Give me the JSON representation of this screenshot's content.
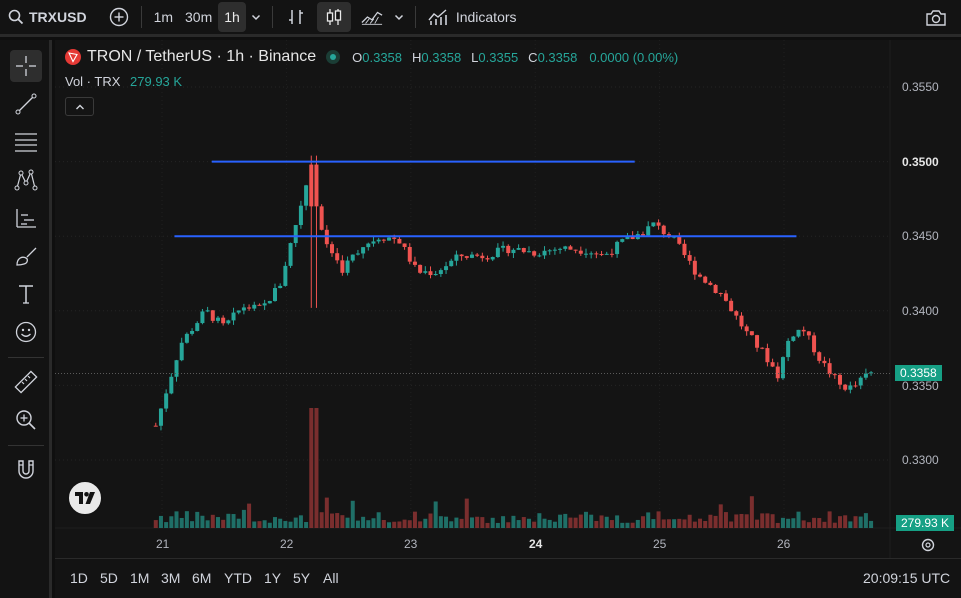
{
  "toolbar": {
    "symbol": "TRXUSD",
    "intervals": [
      "1m",
      "30m",
      "1h"
    ],
    "active_interval": "1h",
    "indicators_label": "Indicators"
  },
  "legend": {
    "title": "TRON / TetherUS · 1h · Binance",
    "o_label": "O",
    "o_value": "0.3358",
    "h_label": "H",
    "h_value": "0.3358",
    "l_label": "L",
    "l_value": "0.3355",
    "c_label": "C",
    "c_value": "0.3358",
    "change": "0.0000 (0.00%)",
    "vol_label": "Vol · TRX",
    "vol_value": "279.93 K"
  },
  "price_axis": {
    "ticks": [
      "0.3550",
      "0.3500",
      "0.3450",
      "0.3400",
      "0.3350",
      "0.3300"
    ],
    "current_price": "0.3358",
    "current_volume": "279.93 K"
  },
  "time_axis": {
    "ticks": [
      "21",
      "22",
      "23",
      "24",
      "25",
      "26"
    ],
    "bold_tick": "24"
  },
  "ranges": [
    "1D",
    "5D",
    "1M",
    "3M",
    "6M",
    "YTD",
    "1Y",
    "5Y",
    "All"
  ],
  "clock": "20:09:15 UTC",
  "colors": {
    "up": "#26a69a",
    "down": "#ef5350",
    "trendline": "#2962ff",
    "price_tag": "#16a085"
  },
  "chart_data": {
    "type": "candlestick",
    "price_range": [
      0.329,
      0.3562
    ],
    "x_range": [
      20.95,
      26.7
    ],
    "hlines": [
      {
        "price": 0.35,
        "from_day": 21.4,
        "to_day": 24.8
      },
      {
        "price": 0.345,
        "from_day": 21.1,
        "to_day": 26.1
      }
    ],
    "anchors": [
      [
        20.95,
        0.3323
      ],
      [
        21.15,
        0.3378
      ],
      [
        21.35,
        0.34
      ],
      [
        21.5,
        0.3389
      ],
      [
        21.65,
        0.3403
      ],
      [
        21.8,
        0.3401
      ],
      [
        21.95,
        0.3418
      ],
      [
        22.1,
        0.3466
      ],
      [
        22.18,
        0.3492
      ],
      [
        22.3,
        0.3448
      ],
      [
        22.45,
        0.3428
      ],
      [
        22.6,
        0.3443
      ],
      [
        22.75,
        0.345
      ],
      [
        22.9,
        0.3448
      ],
      [
        23.05,
        0.3426
      ],
      [
        23.2,
        0.3426
      ],
      [
        23.4,
        0.3437
      ],
      [
        23.6,
        0.3437
      ],
      [
        23.8,
        0.3442
      ],
      [
        24.0,
        0.3439
      ],
      [
        24.2,
        0.3442
      ],
      [
        24.4,
        0.3441
      ],
      [
        24.55,
        0.3437
      ],
      [
        24.7,
        0.3446
      ],
      [
        24.85,
        0.3452
      ],
      [
        24.95,
        0.3458
      ],
      [
        25.1,
        0.3449
      ],
      [
        25.3,
        0.3425
      ],
      [
        25.5,
        0.3411
      ],
      [
        25.7,
        0.3385
      ],
      [
        25.85,
        0.337
      ],
      [
        25.95,
        0.3357
      ],
      [
        26.05,
        0.3384
      ],
      [
        26.15,
        0.3388
      ],
      [
        26.3,
        0.3366
      ],
      [
        26.45,
        0.335
      ],
      [
        26.55,
        0.3348
      ],
      [
        26.68,
        0.3358
      ]
    ],
    "volume_spike_day": 22.22
  }
}
